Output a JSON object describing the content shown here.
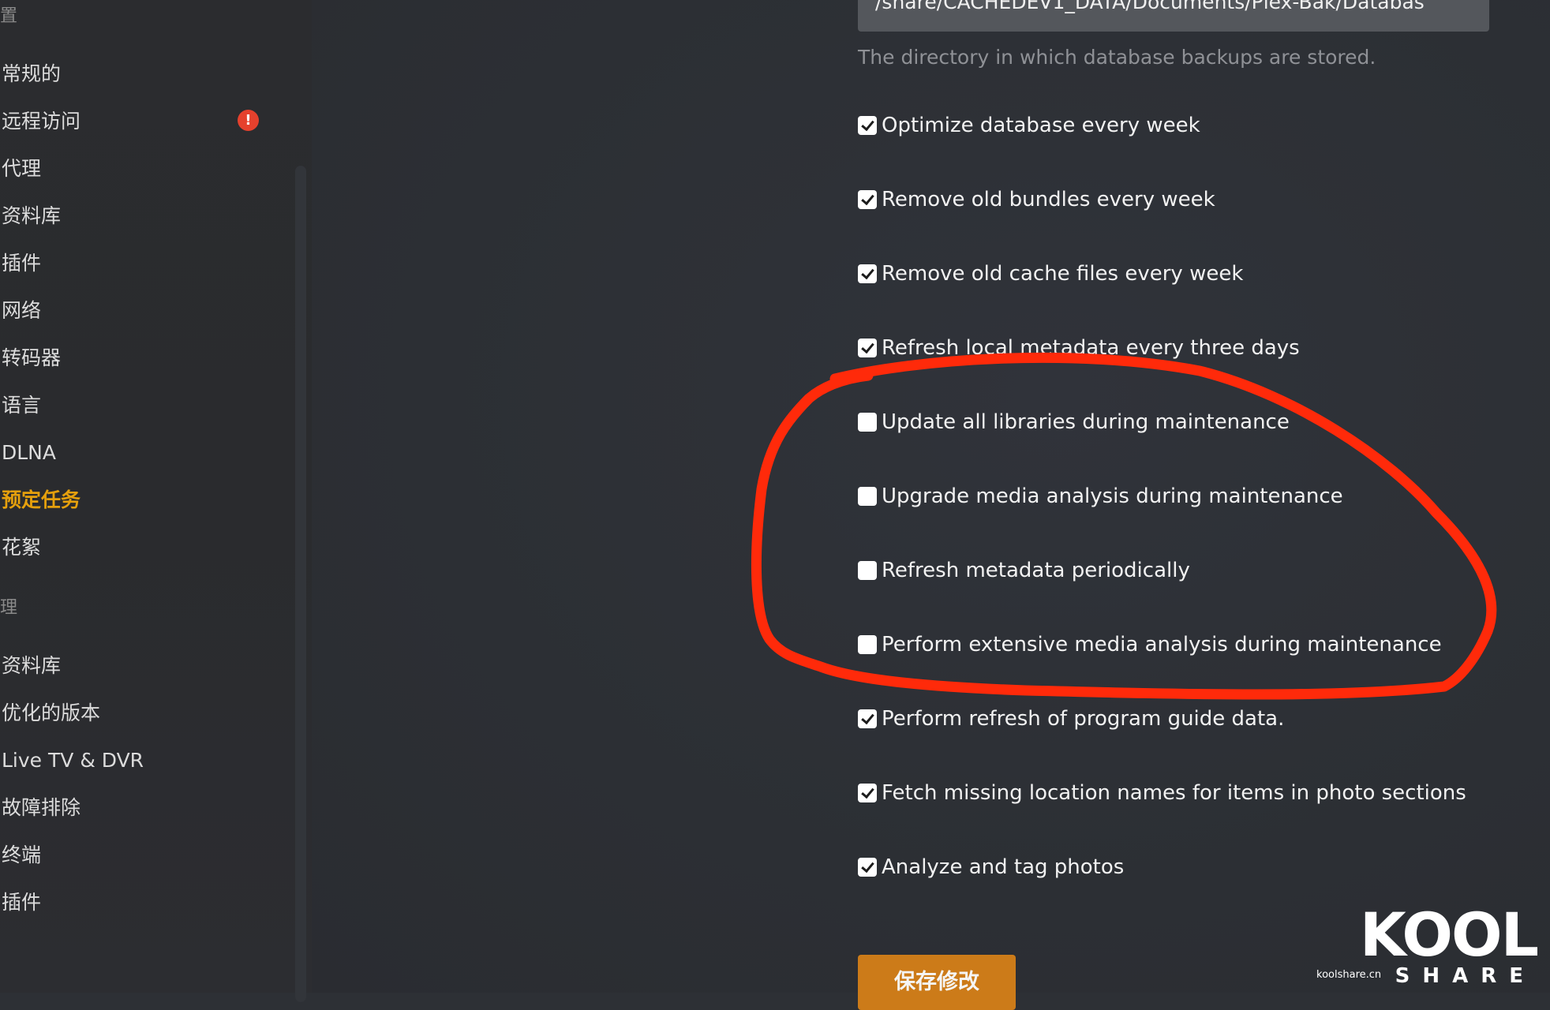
{
  "sidebar": {
    "section_settings": "置",
    "items_settings": [
      {
        "label": "常规的"
      },
      {
        "label": "远程访问",
        "alert": "!"
      },
      {
        "label": "代理"
      },
      {
        "label": "资料库"
      },
      {
        "label": "插件"
      },
      {
        "label": "网络"
      },
      {
        "label": "转码器"
      },
      {
        "label": "语言"
      },
      {
        "label": "DLNA"
      },
      {
        "label": "预定任务",
        "active": true
      },
      {
        "label": "花絮"
      }
    ],
    "section_manage": "理",
    "items_manage": [
      {
        "label": "资料库"
      },
      {
        "label": "优化的版本"
      },
      {
        "label": "Live TV & DVR"
      },
      {
        "label": "故障排除"
      },
      {
        "label": "终端"
      },
      {
        "label": "插件"
      }
    ]
  },
  "main": {
    "backup_path_value": "/share/CACHEDEV1_DATA/Documents/Plex-Bak/Databas",
    "backup_path_help": "The directory in which database backups are stored.",
    "options": [
      {
        "label": "Optimize database every week",
        "checked": true
      },
      {
        "label": "Remove old bundles every week",
        "checked": true
      },
      {
        "label": "Remove old cache files every week",
        "checked": true
      },
      {
        "label": "Refresh local metadata every three days",
        "checked": true
      },
      {
        "label": "Update all libraries during maintenance",
        "checked": false
      },
      {
        "label": "Upgrade media analysis during maintenance",
        "checked": false
      },
      {
        "label": "Refresh metadata periodically",
        "checked": false
      },
      {
        "label": "Perform extensive media analysis during maintenance",
        "checked": false
      },
      {
        "label": "Perform refresh of program guide data.",
        "checked": true
      },
      {
        "label": "Fetch missing location names for items in photo sections",
        "checked": true
      },
      {
        "label": "Analyze and tag photos",
        "checked": true
      }
    ],
    "save_label": "保存修改"
  },
  "watermark": {
    "logo": "KOOL",
    "sub": "SHARE",
    "domain": "koolshare.cn"
  },
  "colors": {
    "accent": "#e5a00d",
    "save_button": "#cc7b19",
    "annotation": "#ff2a0a",
    "alert": "#e5412d"
  }
}
